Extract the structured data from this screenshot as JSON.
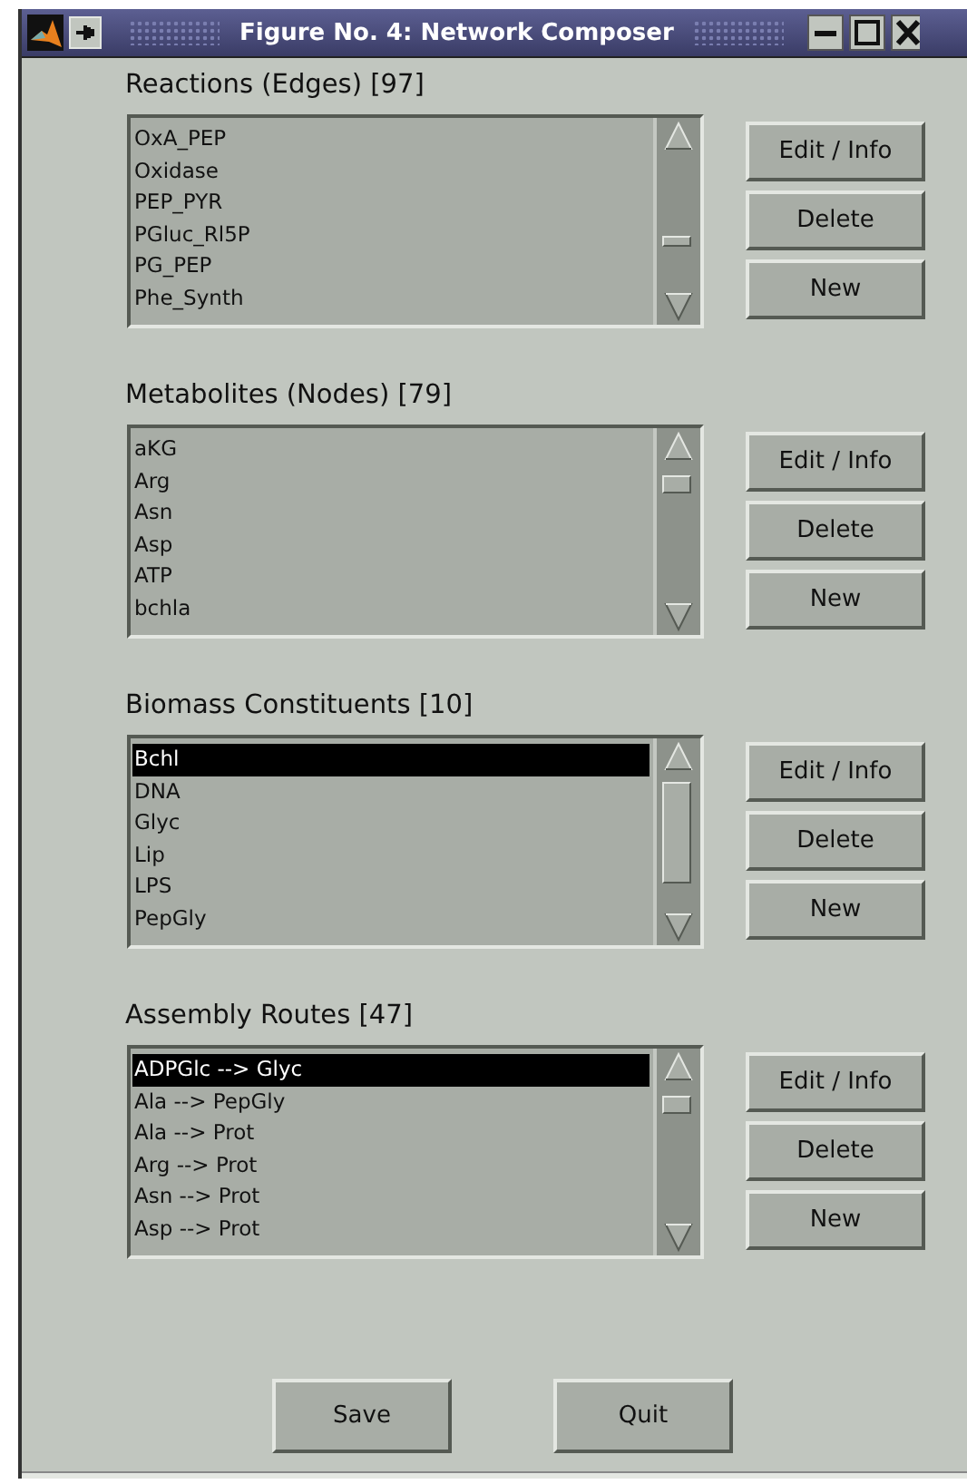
{
  "window": {
    "title": "Figure No. 4: Network Composer"
  },
  "sections": [
    {
      "title": "Reactions (Edges) [97]",
      "items": [
        {
          "label": "OxA_PEP",
          "selected": false
        },
        {
          "label": "Oxidase",
          "selected": false
        },
        {
          "label": "PEP_PYR",
          "selected": false
        },
        {
          "label": "PGluc_Rl5P",
          "selected": false
        },
        {
          "label": "PG_PEP",
          "selected": false
        },
        {
          "label": "Phe_Synth",
          "selected": false
        }
      ],
      "buttons": [
        "Edit / Info",
        "Delete",
        "New"
      ]
    },
    {
      "title": "Metabolites (Nodes) [79]",
      "items": [
        {
          "label": "aKG",
          "selected": false
        },
        {
          "label": "Arg",
          "selected": false
        },
        {
          "label": "Asn",
          "selected": false
        },
        {
          "label": "Asp",
          "selected": false
        },
        {
          "label": "ATP",
          "selected": false
        },
        {
          "label": "bchla",
          "selected": false
        }
      ],
      "buttons": [
        "Edit / Info",
        "Delete",
        "New"
      ]
    },
    {
      "title": "Biomass Constituents [10]",
      "items": [
        {
          "label": "Bchl",
          "selected": true
        },
        {
          "label": "DNA",
          "selected": false
        },
        {
          "label": "Glyc",
          "selected": false
        },
        {
          "label": "Lip",
          "selected": false
        },
        {
          "label": "LPS",
          "selected": false
        },
        {
          "label": "PepGly",
          "selected": false
        }
      ],
      "buttons": [
        "Edit / Info",
        "Delete",
        "New"
      ]
    },
    {
      "title": "Assembly Routes [47]",
      "items": [
        {
          "label": "ADPGlc --> Glyc",
          "selected": true
        },
        {
          "label": "Ala --> PepGly",
          "selected": false
        },
        {
          "label": "Ala --> Prot",
          "selected": false
        },
        {
          "label": "Arg --> Prot",
          "selected": false
        },
        {
          "label": "Asn --> Prot",
          "selected": false
        },
        {
          "label": "Asp --> Prot",
          "selected": false
        }
      ],
      "buttons": [
        "Edit / Info",
        "Delete",
        "New"
      ]
    }
  ],
  "footer_buttons": [
    "Save",
    "Quit"
  ]
}
